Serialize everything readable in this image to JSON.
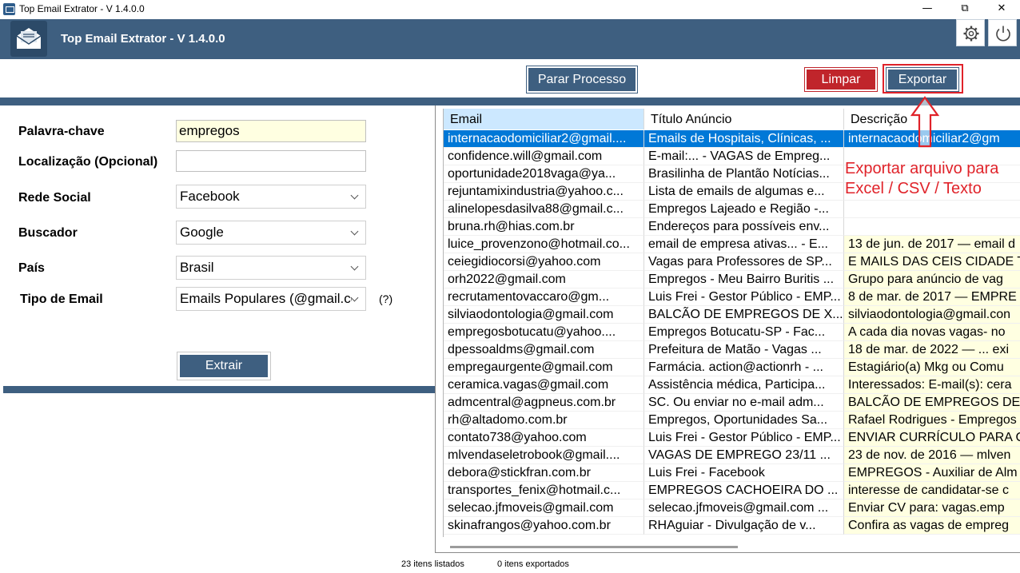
{
  "window": {
    "title": "Top Email Extrator - V 1.4.0.0",
    "minimize_glyph": "—",
    "maximize_glyph": "⧉",
    "close_glyph": "✕"
  },
  "header": {
    "title": "Top Email Extrator - V 1.4.0.0",
    "logo_icon": "envelope-icon",
    "settings_icon": "gear-icon",
    "power_icon": "power-icon"
  },
  "toolbar": {
    "stop_label": "Parar Processo",
    "clear_label": "Limpar",
    "export_label": "Exportar"
  },
  "form": {
    "keyword_label": "Palavra-chave",
    "keyword_value": "empregos",
    "location_label": "Localização (Opcional)",
    "location_value": "",
    "social_label": "Rede Social",
    "social_value": "Facebook",
    "engine_label": "Buscador",
    "engine_value": "Google",
    "country_label": "País",
    "country_value": "Brasil",
    "email_type_label": "Tipo de Email",
    "email_type_value": "Emails Populares (@gmail.com",
    "help_label": "(?)",
    "extract_label": "Extrair"
  },
  "grid": {
    "columns": [
      "Email",
      "Título Anúncio",
      "Descrição"
    ],
    "rows": [
      [
        "internacaodomiciliar2@gmail....",
        "Emails de Hospitais, Clínicas, ...",
        "internacaodomiciliar2@gm"
      ],
      [
        "confidence.will@gmail.com",
        "E-mail:... - VAGAS de Empreg...",
        ""
      ],
      [
        "oportunidade2018vaga@ya...",
        "Brasilinha de Plantão Notícias...",
        ""
      ],
      [
        "rejuntamixindustria@yahoo.c...",
        "Lista de emails de algumas e...",
        ""
      ],
      [
        "alinelopesdasilva88@gmail.c...",
        "Empregos Lajeado e Região -...",
        ""
      ],
      [
        "bruna.rh@hias.com.br",
        "Endereços para possíveis env...",
        ""
      ],
      [
        "luice_provenzono@hotmail.co...",
        "email de empresa ativas... - E...",
        "13 de jun. de 2017 — email d"
      ],
      [
        "ceiegidiocorsi@yahoo.com",
        "Vagas para Professores de SP...",
        "E MAILS DAS CEIS CIDADE T"
      ],
      [
        "orh2022@gmail.com",
        "Empregos - Meu Bairro Buritis ...",
        "Grupo para anúncio de vag"
      ],
      [
        "recrutamentovaccaro@gm...",
        "Luis Frei - Gestor Público - EMP...",
        "8 de mar. de 2017 — EMPRE"
      ],
      [
        "silviaodontologia@gmail.com",
        "BALCÃO DE EMPREGOS DE X...",
        "silviaodontologia@gmail.con"
      ],
      [
        "empregosbotucatu@yahoo....",
        "Empregos Botucatu-SP - Fac...",
        "A cada dia novas vagas- no"
      ],
      [
        "dpessoaldms@gmail.com",
        "Prefeitura de Matão - Vagas ...",
        "18 de mar. de 2022 — ... exi"
      ],
      [
        "empregaurgente@gmail.com",
        "Farmácia. action@actionrh - ...",
        "Estagiário(a) Mkg ou Comu"
      ],
      [
        "ceramica.vagas@gmail.com",
        "Assistência médica, Participa...",
        "Interessados: E-mail(s): cera"
      ],
      [
        "admcentral@agpneus.com.br",
        "SC. Ou enviar no e-mail adm...",
        "BALCÃO DE EMPREGOS DE"
      ],
      [
        "rh@altadomo.com.br",
        "Empregos, Oportunidades Sa...",
        "Rafael Rodrigues - Empregos"
      ],
      [
        "contato738@yahoo.com",
        "Luis Frei - Gestor Público - EMP...",
        "ENVIAR CURRÍCULO PARA C"
      ],
      [
        "mlvendaseletrobook@gmail....",
        "VAGAS DE EMPREGO 23/11 ...",
        "23 de nov. de 2016 — mlven"
      ],
      [
        "debora@stickfran.com.br",
        "Luis Frei - Facebook",
        "EMPREGOS - Auxiliar de Alm"
      ],
      [
        "transportes_fenix@hotmail.c...",
        "EMPREGOS CACHOEIRA DO ...",
        "interesse de candidatar-se c"
      ],
      [
        "selecao.jfmoveis@gmail.com",
        "selecao.jfmoveis@gmail.com ...",
        "Enviar CV para: vagas.emp"
      ],
      [
        "skinafrangos@yahoo.com.br",
        "RHAguiar - Divulgação de v...",
        "Confira as vagas de empreg"
      ]
    ]
  },
  "annotation": {
    "line1": "Exportar arquivo para",
    "line2": "Excel / CSV / Texto",
    "arrow_icon": "up-arrow-icon"
  },
  "status": {
    "listed": "23 itens listados",
    "exported": "0  itens exportados"
  },
  "colors": {
    "brand": "#3e5f80",
    "danger": "#c0252b",
    "annotation": "#e0232a",
    "selection": "#0078d7",
    "highlight": "#ffffe1"
  }
}
